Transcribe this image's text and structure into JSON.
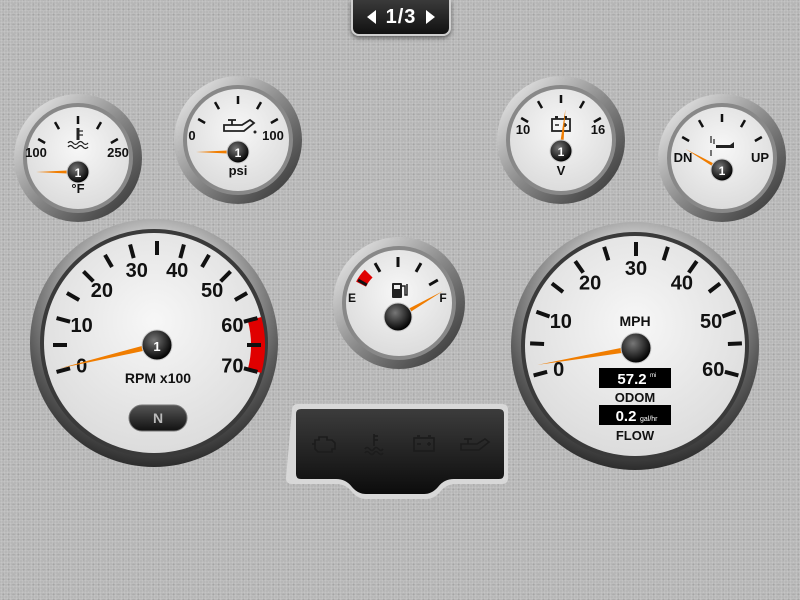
{
  "pager": {
    "label": "1/3"
  },
  "gauges": {
    "temp": {
      "min_label": "100",
      "max_label": "250",
      "unit": "°F",
      "center": "1",
      "value": 100,
      "icon": "coolant-temp-icon"
    },
    "oil": {
      "min_label": "0",
      "max_label": "100",
      "unit": "psi",
      "center": "1",
      "value": 0,
      "icon": "oil-can-icon"
    },
    "volt": {
      "min_label": "10",
      "max_label": "16",
      "unit": "V",
      "center": "1",
      "value": 13.2,
      "icon": "battery-icon"
    },
    "trim": {
      "min_label": "DN",
      "max_label": "UP",
      "center": "1",
      "value": 0,
      "icon": "trim-icon"
    },
    "rpm": {
      "ticks": [
        "0",
        "10",
        "20",
        "30",
        "40",
        "50",
        "60",
        "70"
      ],
      "unit": "RPM x100",
      "center": "1",
      "value": 0.5,
      "redline_start": 60,
      "gear": "N"
    },
    "fuel": {
      "empty_label": "E",
      "full_label": "F",
      "value": 1.0,
      "icon": "fuel-pump-icon"
    },
    "speed": {
      "ticks": [
        "0",
        "10",
        "20",
        "30",
        "40",
        "50",
        "60"
      ],
      "unit": "MPH",
      "value": 1.5,
      "odometer": {
        "value": "57.2",
        "unit": "mi",
        "label": "ODOM"
      },
      "flow": {
        "value": "0.2",
        "unit": "gal/hr",
        "label": "FLOW"
      }
    }
  },
  "warning_panel": {
    "icons": [
      "check-engine-icon",
      "coolant-temp-warning-icon",
      "battery-warning-icon",
      "oil-pressure-warning-icon"
    ]
  },
  "colors": {
    "needle": "#f07d00",
    "redline": "#e00000",
    "face": "#ededed"
  }
}
